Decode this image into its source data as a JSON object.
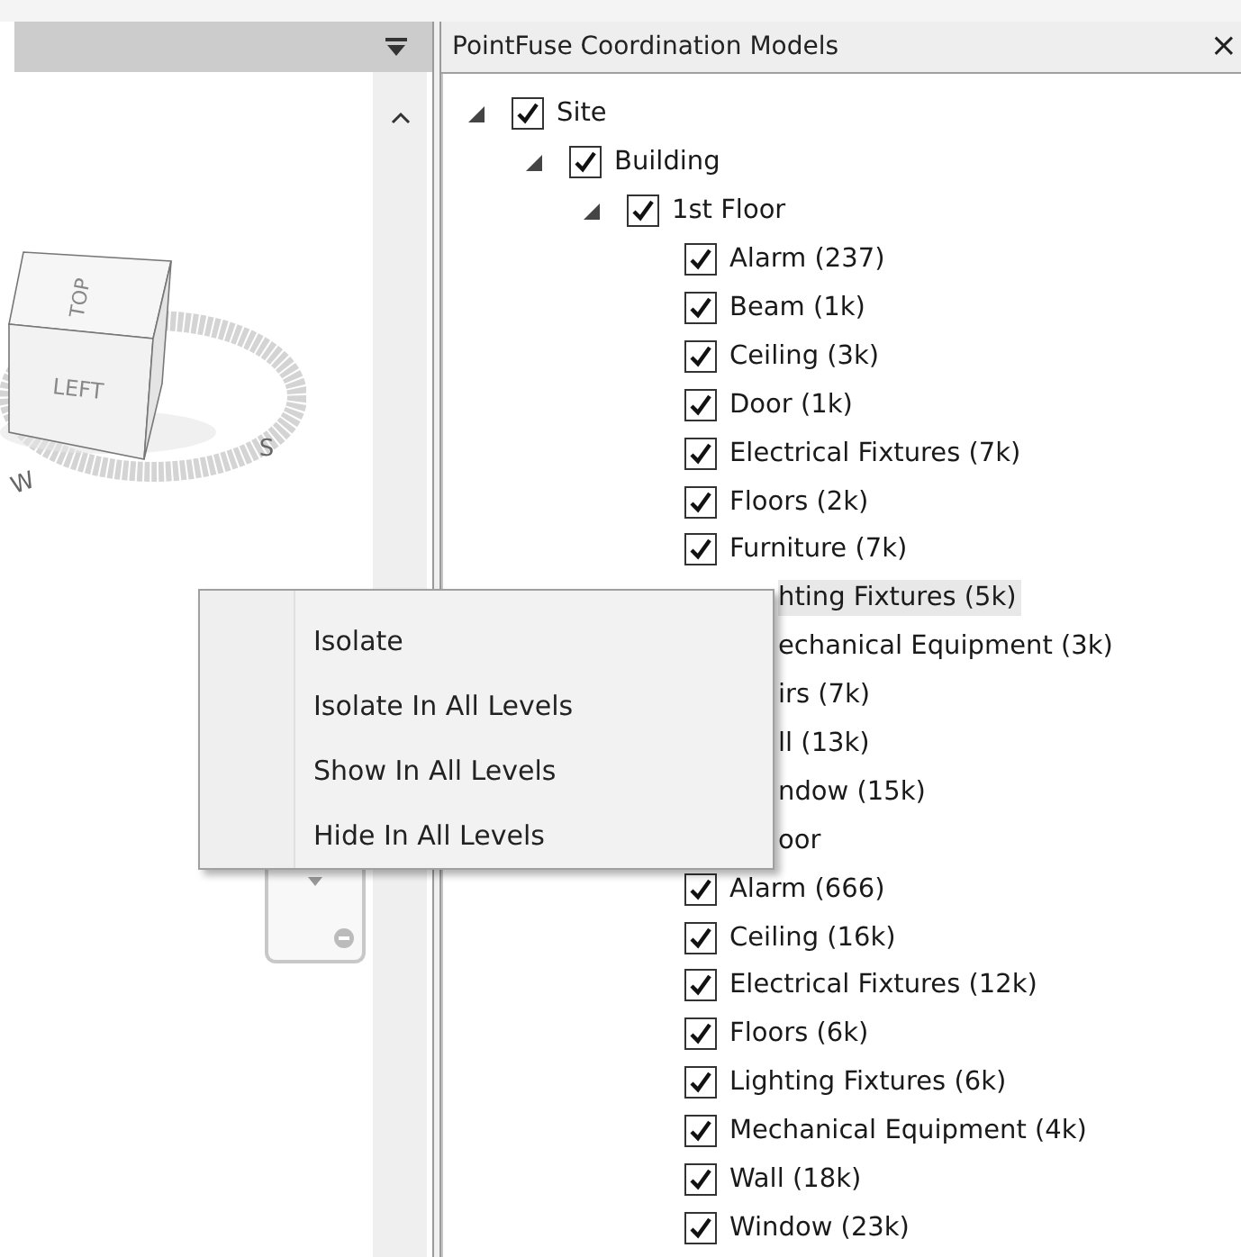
{
  "viewer": {
    "cube_faces": [
      "TOP",
      "LEFT"
    ],
    "compass": [
      "S",
      "W"
    ]
  },
  "panel": {
    "title": "PointFuse Coordination Models",
    "close": "×"
  },
  "tree": [
    {
      "label": "Site",
      "kind": "node",
      "checked": true,
      "expanded": true,
      "children": [
        {
          "label": "Building",
          "kind": "node",
          "checked": true,
          "expanded": true,
          "children": [
            {
              "label": "1st Floor",
              "kind": "node",
              "checked": true,
              "expanded": true,
              "children": [
                {
                  "label": "Alarm (237)",
                  "kind": "node",
                  "checked": true,
                  "selected": false
                },
                {
                  "label": "Beam (1k)",
                  "kind": "node",
                  "checked": true,
                  "selected": false
                },
                {
                  "label": "Ceiling (3k)",
                  "kind": "node",
                  "checked": true,
                  "selected": false
                },
                {
                  "label": "Door (1k)",
                  "kind": "node",
                  "checked": true,
                  "selected": false
                },
                {
                  "label": "Electrical Fixtures (7k)",
                  "kind": "node",
                  "checked": true,
                  "selected": false
                },
                {
                  "label": "Floors (2k)",
                  "kind": "node",
                  "checked": true,
                  "selected": false
                },
                {
                  "label": "Furniture (7k)",
                  "kind": "node",
                  "checked": true,
                  "selected": false
                },
                {
                  "label": "hting Fixtures (5k)",
                  "kind": "covered",
                  "selected": true
                },
                {
                  "label": "echanical Equipment (3k)",
                  "kind": "covered",
                  "selected": false
                },
                {
                  "label": "irs (7k)",
                  "kind": "covered",
                  "selected": false
                },
                {
                  "label": "ll (13k)",
                  "kind": "covered",
                  "selected": false
                },
                {
                  "label": "ndow (15k)",
                  "kind": "covered",
                  "selected": false
                }
              ]
            },
            {
              "label": "oor",
              "kind": "covered",
              "expanded": true,
              "children": [
                {
                  "label": "Alarm (666)",
                  "kind": "node",
                  "checked": true,
                  "selected": false
                },
                {
                  "label": "Ceiling (16k)",
                  "kind": "node",
                  "checked": true,
                  "selected": false
                },
                {
                  "label": "Electrical Fixtures (12k)",
                  "kind": "node",
                  "checked": true,
                  "selected": false
                },
                {
                  "label": "Floors (6k)",
                  "kind": "node",
                  "checked": true,
                  "selected": false
                },
                {
                  "label": "Lighting Fixtures (6k)",
                  "kind": "node",
                  "checked": true,
                  "selected": false
                },
                {
                  "label": "Mechanical Equipment (4k)",
                  "kind": "node",
                  "checked": true,
                  "selected": false
                },
                {
                  "label": "Wall (18k)",
                  "kind": "node",
                  "checked": true,
                  "selected": false
                },
                {
                  "label": "Window (23k)",
                  "kind": "node",
                  "checked": true,
                  "selected": false
                }
              ]
            }
          ]
        }
      ]
    }
  ],
  "context_menu": {
    "items": [
      "Isolate",
      "Isolate In All Levels",
      "Show In All Levels",
      "Hide In All Levels"
    ]
  }
}
